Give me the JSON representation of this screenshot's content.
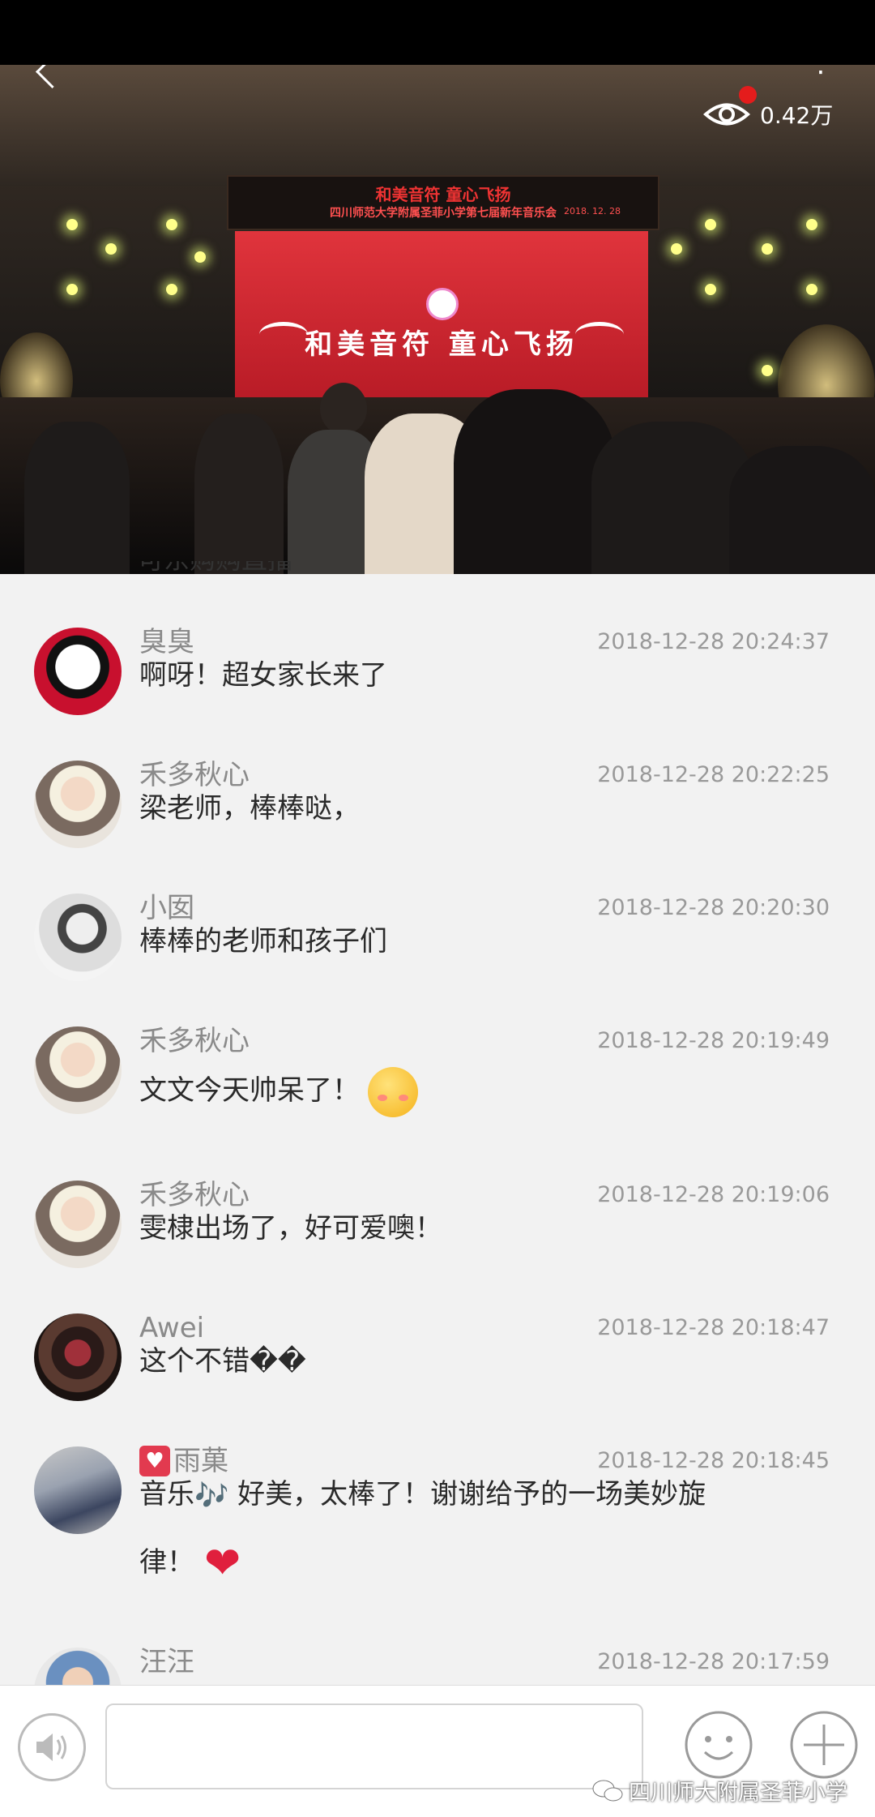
{
  "video": {
    "banner_title": "和美音符 童心飞扬",
    "banner_subtitle": "四川师范大学附属圣菲小学第七届新年音乐会",
    "banner_date": "2018. 12. 28",
    "backdrop_text": "和美音符 童心飞扬",
    "viewer_count": "0.42万",
    "partial_comment": "可东购购直播"
  },
  "comments": [
    {
      "user": "臭臭",
      "time": "2018-12-28 20:24:37",
      "text": "啊呀！超女家长来了",
      "avatar": "cartoon-face"
    },
    {
      "user": "禾多秋心",
      "time": "2018-12-28 20:22:25",
      "text": "梁老师，棒棒哒，",
      "avatar": "girl-hat"
    },
    {
      "user": "小囡",
      "time": "2018-12-28 20:20:30",
      "text": "棒棒的老师和孩子们",
      "avatar": "sketch-portrait"
    },
    {
      "user": "禾多秋心",
      "time": "2018-12-28 20:19:49",
      "text": "文文今天帅呆了！",
      "avatar": "girl-hat"
    },
    {
      "user": "禾多秋心",
      "time": "2018-12-28 20:19:06",
      "text": "雯棣出场了，好可爱噢！",
      "avatar": "girl-hat"
    },
    {
      "user": "Awei",
      "time": "2018-12-28 20:18:47",
      "text": "这个不错��",
      "avatar": "shop-window"
    },
    {
      "user": "雨菓",
      "time": "2018-12-28 20:18:45",
      "text_a": "音乐",
      "text_b": " 好美，太棒了！谢谢给予的一场美妙旋",
      "text_c": "律！",
      "avatar": "shadows"
    },
    {
      "user": "汪汪",
      "time": "2018-12-28 20:17:59",
      "text": "",
      "avatar": "kid-photo"
    }
  ],
  "input": {
    "placeholder": ""
  },
  "watermark": "四川师大附属圣菲小学",
  "icons": {
    "back": "back-arrow-icon",
    "more": "more-vertical-icon",
    "eye": "eye-icon",
    "voice": "speaker-icon",
    "emoji": "smiley-icon",
    "plus": "plus-icon",
    "wechat": "wechat-icon"
  },
  "colors": {
    "badge_red": "#e41c1c",
    "heart": "#e01f3d",
    "name_gray": "#8a8a8a"
  }
}
